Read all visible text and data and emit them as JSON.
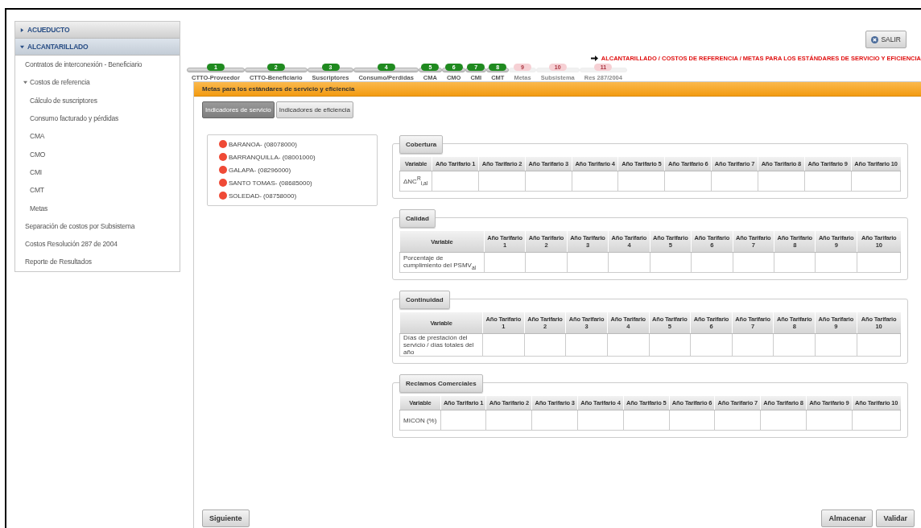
{
  "sidebar": {
    "groups": [
      {
        "label": "ACUEDUCTO",
        "expanded": false
      },
      {
        "label": "ALCANTARILLADO",
        "expanded": true,
        "items": [
          {
            "label": "Contratos de interconexión - Beneficiario"
          },
          {
            "label": "Costos de referencia",
            "expanded": true,
            "children": [
              {
                "label": "Cálculo de suscriptores"
              },
              {
                "label": "Consumo facturado y pérdidas"
              },
              {
                "label": "CMA"
              },
              {
                "label": "CMO"
              },
              {
                "label": "CMI"
              },
              {
                "label": "CMT"
              },
              {
                "label": "Metas"
              }
            ]
          },
          {
            "label": "Separación de costos por Subsistema"
          },
          {
            "label": "Costos Resolución 287 de 2004"
          },
          {
            "label": "Reporte de Resultados"
          }
        ]
      }
    ]
  },
  "exit_button": "SALIR",
  "breadcrumb": "ALCANTARILLADO / COSTOS DE REFERENCIA / METAS PARA LOS ESTÁNDARES DE SERVICIO Y EFICIENCIA",
  "steps": [
    {
      "number": "1",
      "label": "CTTO-Proveedor",
      "enabled": true
    },
    {
      "number": "2",
      "label": "CTTO-Beneficiario",
      "enabled": true
    },
    {
      "number": "3",
      "label": "Suscriptores",
      "enabled": true
    },
    {
      "number": "4",
      "label": "Consumo/Perdidas",
      "enabled": true
    },
    {
      "number": "5",
      "label": "CMA",
      "enabled": true
    },
    {
      "number": "6",
      "label": "CMO",
      "enabled": true
    },
    {
      "number": "7",
      "label": "CMI",
      "enabled": true
    },
    {
      "number": "8",
      "label": "CMT",
      "enabled": true
    },
    {
      "number": "9",
      "label": "Metas",
      "enabled": false
    },
    {
      "number": "10",
      "label": "Subsistema",
      "enabled": false
    },
    {
      "number": "11",
      "label": "Res 287/2004",
      "enabled": false
    }
  ],
  "panel_title": "Metas para los estándares de servicio y eficiencia",
  "tabs": [
    {
      "label": "Indicadores de servicio",
      "selected": true
    },
    {
      "label": "Indicadores de eficiencia",
      "selected": false
    }
  ],
  "municipalities": [
    "BARANOA- (08078000)",
    "BARRANQUILLA- (08001000)",
    "GALAPA- (08296000)",
    "SANTO TOMAS- (08685000)",
    "SOLEDAD- (08758000)"
  ],
  "sections": [
    {
      "title": "Cobertura",
      "columns": [
        "Variable",
        "Año Tarifario 1",
        "Año Tarifario 2",
        "Año Tarifario 3",
        "Año Tarifario 4",
        "Año Tarifario 5",
        "Año Tarifario 6",
        "Año Tarifario 7",
        "Año Tarifario 8",
        "Año Tarifario 9",
        "Año Tarifario 10"
      ],
      "variable": "ΔNC$^{R}$$_{i,al}$"
    },
    {
      "title": "Calidad",
      "columns": [
        "Variable",
        "Año Tarifario 1",
        "Año Tarifario 2",
        "Año Tarifario 3",
        "Año Tarifario 4",
        "Año Tarifario 5",
        "Año Tarifario 6",
        "Año Tarifario 7",
        "Año Tarifario 8",
        "Año Tarifario 9",
        "Año Tarifario 10"
      ],
      "variable": "Porcentaje de cumplimiento del PSMV$_{al}$"
    },
    {
      "title": "Continuidad",
      "columns": [
        "Variable",
        "Año Tarifario 1",
        "Año Tarifario 2",
        "Año Tarifario 3",
        "Año Tarifario 4",
        "Año Tarifario 5",
        "Año Tarifario 6",
        "Año Tarifario 7",
        "Año Tarifario 8",
        "Año Tarifario 9",
        "Año Tarifario 10"
      ],
      "variable": "Días de prestación del servicio / días totales del año"
    },
    {
      "title": "Reclamos Comerciales",
      "columns": [
        "Variable",
        "Año Tarifario 1",
        "Año Tarifario 2",
        "Año Tarifario 3",
        "Año Tarifario 4",
        "Año Tarifario 5",
        "Año Tarifario 6",
        "Año Tarifario 7",
        "Año Tarifario 8",
        "Año Tarifario 9",
        "Año Tarifario 10"
      ],
      "variable": "MICON (%)"
    }
  ],
  "buttons": {
    "next": "Siguiente",
    "save": "Almacenar",
    "validate": "Validar"
  }
}
